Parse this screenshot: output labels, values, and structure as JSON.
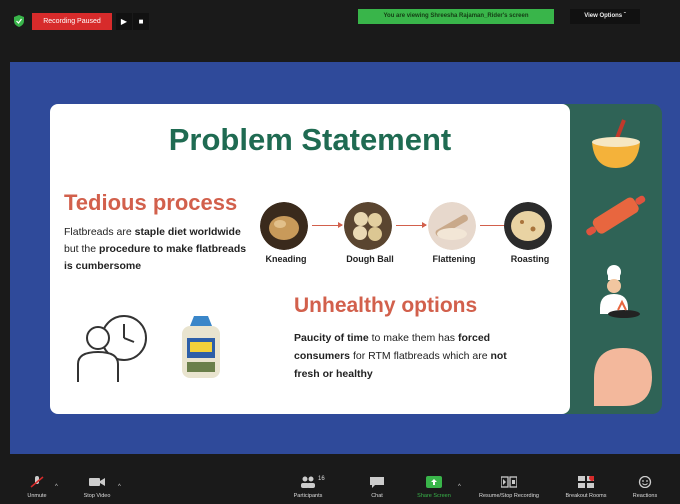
{
  "topbar": {
    "recording_label": "Recording Paused",
    "play_glyph": "▶",
    "stop_glyph": "■",
    "viewing_banner": "You are viewing Shreesha Rajaman_Rider's screen",
    "view_options": "View Options ˇ"
  },
  "slide": {
    "title": "Problem Statement",
    "tedious": {
      "heading": "Tedious process",
      "body_parts": [
        "Flatbreads are ",
        "staple diet worldwide",
        " but the ",
        "procedure to make flatbreads is cumbersome"
      ]
    },
    "steps": [
      {
        "label": "Kneading"
      },
      {
        "label": "Dough Ball"
      },
      {
        "label": "Flattening"
      },
      {
        "label": "Roasting"
      }
    ],
    "unhealthy": {
      "heading": "Unhealthy options",
      "body_parts": [
        "Paucity of time",
        " to make them has ",
        "forced consumers",
        " for RTM flatbreads which are ",
        "not fresh or healthy"
      ]
    }
  },
  "toolbar": {
    "unmute": "Unmute",
    "stop_video": "Stop Video",
    "participants": "Participants",
    "participants_count": "16",
    "chat": "Chat",
    "share_screen": "Share Screen",
    "recording": "Resume/Stop Recording",
    "breakout": "Breakout Rooms",
    "reactions": "Reactions"
  },
  "colors": {
    "recording_red": "#d72b2b",
    "banner_green": "#39b54a",
    "share_blue": "#2f4a9a",
    "slide_teal": "#2f6356",
    "title_green": "#1f6b52",
    "heading_coral": "#d2604c"
  }
}
